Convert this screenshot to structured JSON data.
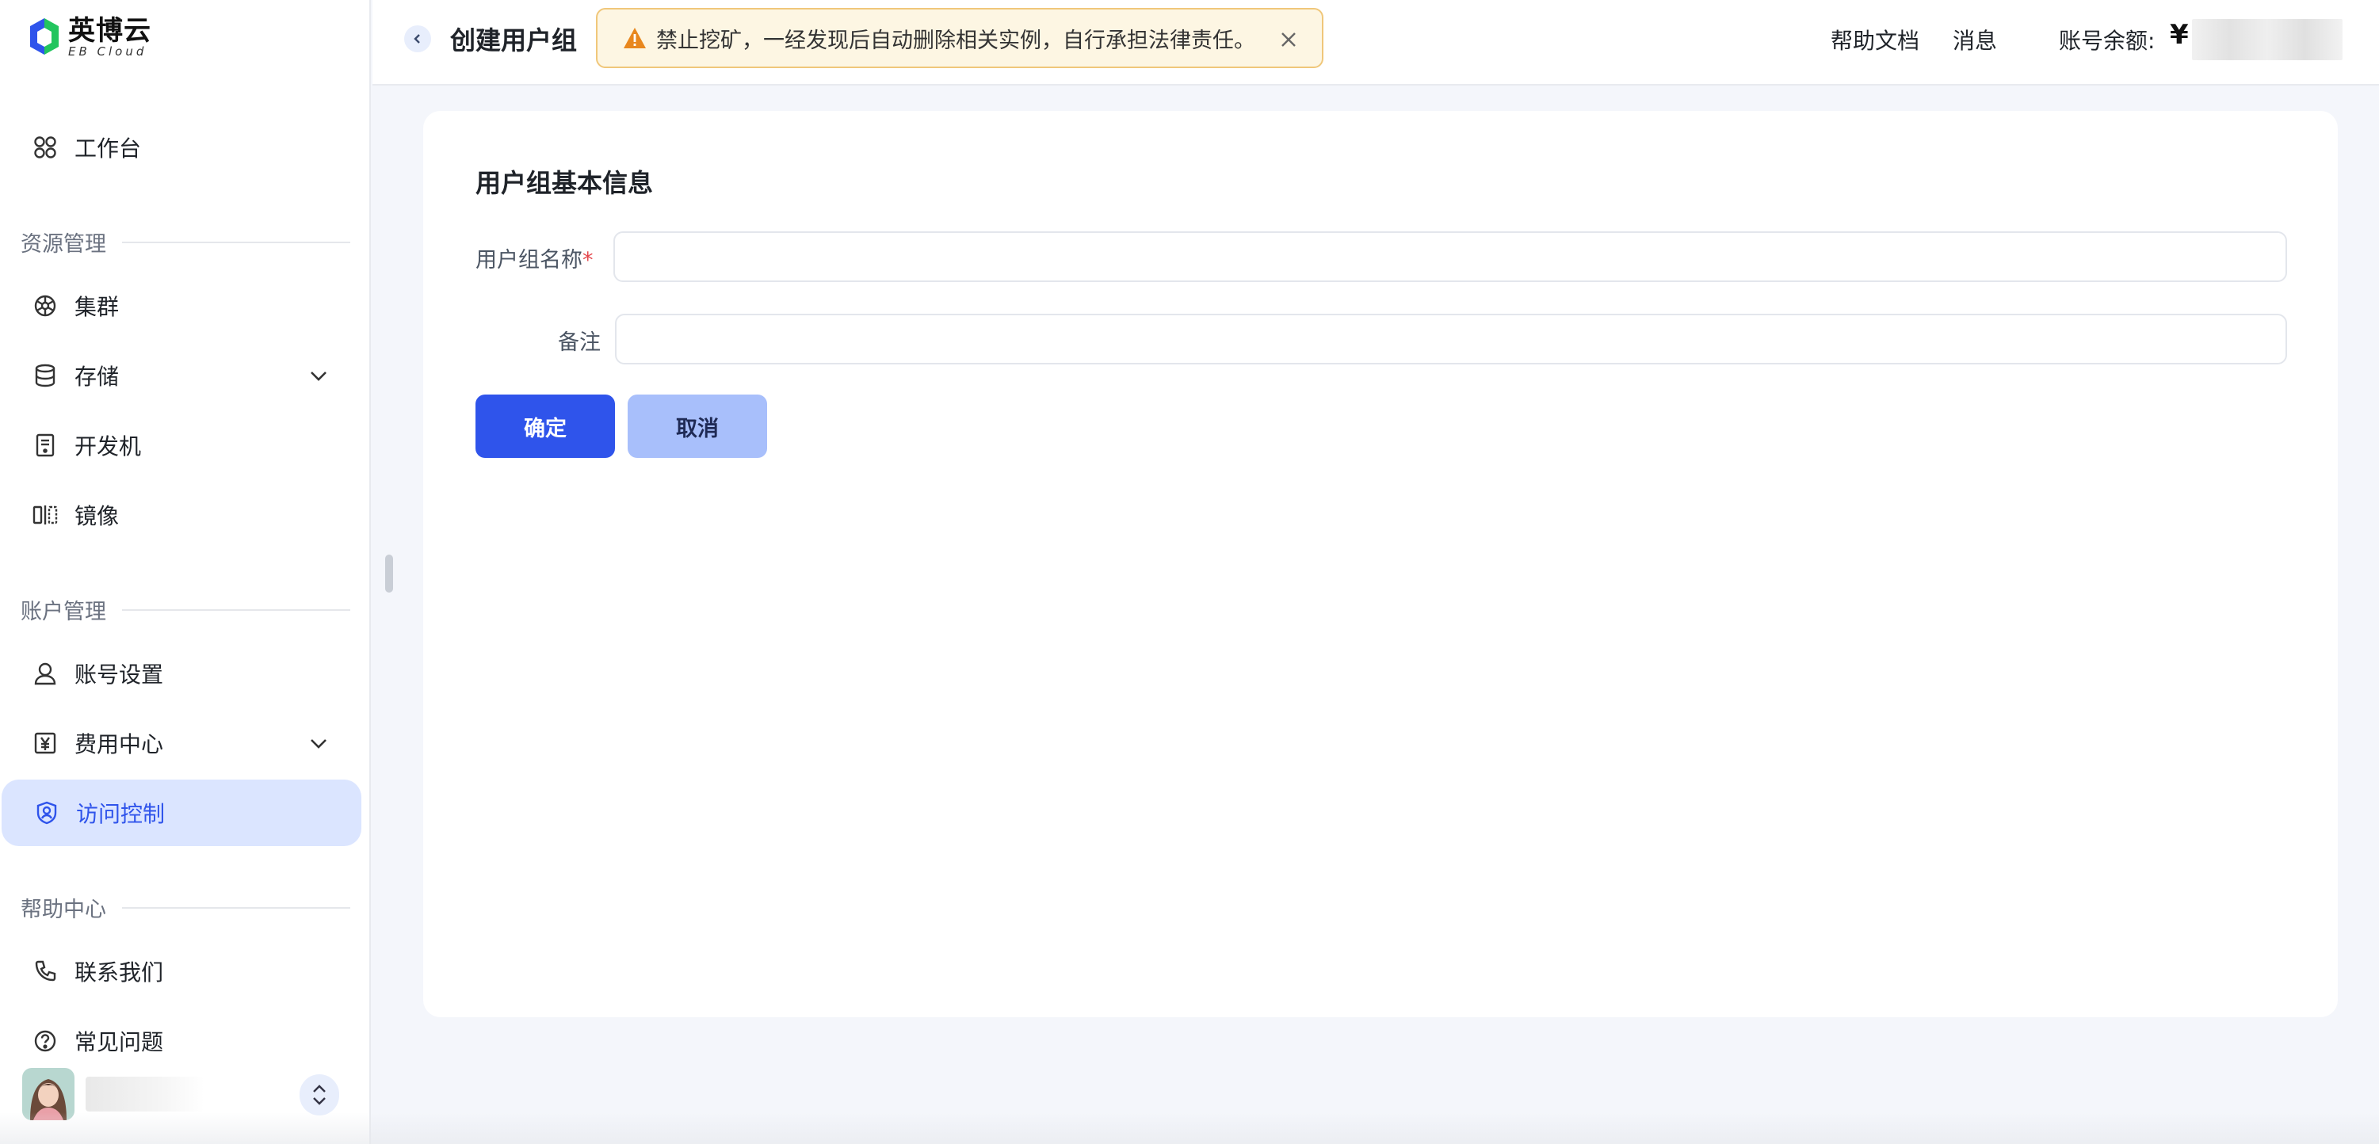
{
  "brand": {
    "name_cn": "英博云",
    "name_en": "EB Cloud"
  },
  "sidebar": {
    "workbench": "工作台",
    "sections": [
      {
        "title": "资源管理",
        "items": [
          "集群",
          "存储",
          "开发机",
          "镜像"
        ]
      },
      {
        "title": "账户管理",
        "items": [
          "账号设置",
          "费用中心",
          "访问控制"
        ]
      },
      {
        "title": "帮助中心",
        "items": [
          "联系我们",
          "常见问题"
        ]
      }
    ],
    "active_item": "访问控制"
  },
  "header": {
    "page_title": "创建用户组",
    "alert_text": "禁止挖矿，一经发现后自动删除相关实例，自行承担法律责任。",
    "links": [
      "帮助文档",
      "消息"
    ],
    "balance_label": "账号余额:",
    "balance_currency": "¥"
  },
  "form": {
    "section_title": "用户组基本信息",
    "name_label": "用户组名称",
    "name_required_mark": "*",
    "name_value": "",
    "remark_label": "备注",
    "remark_value": "",
    "confirm_label": "确定",
    "cancel_label": "取消"
  },
  "colors": {
    "primary": "#2f54eb",
    "active_bg": "#dbe5ff",
    "alert_bg": "#fdf6e3",
    "alert_border": "#f0c77a",
    "warning": "#e8871e"
  }
}
